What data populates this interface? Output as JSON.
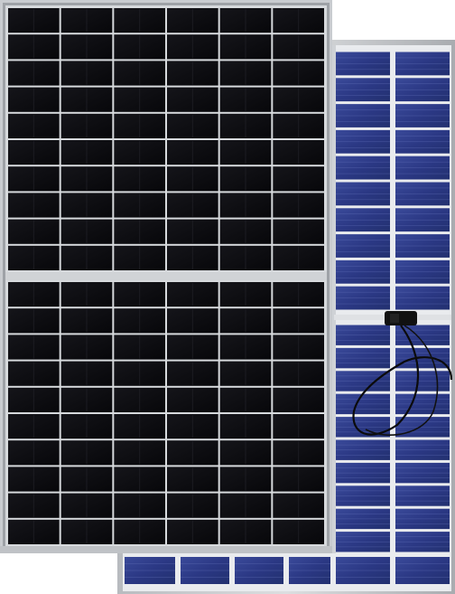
{
  "image": {
    "subject": "bifacial-solar-panels",
    "panels": [
      {
        "id": "front-panel",
        "face": "monocrystalline-half-cell",
        "cell_color": "#0c0c10",
        "frame_color": "#c9ccd0",
        "columns": 6,
        "rows_per_half": 10,
        "halves": 2
      },
      {
        "id": "rear-panel",
        "face": "bifacial-backside",
        "cell_color": "#2c3a86",
        "frame_color": "#c7c9cc",
        "junction_boxes": 1,
        "cable": true
      }
    ]
  }
}
